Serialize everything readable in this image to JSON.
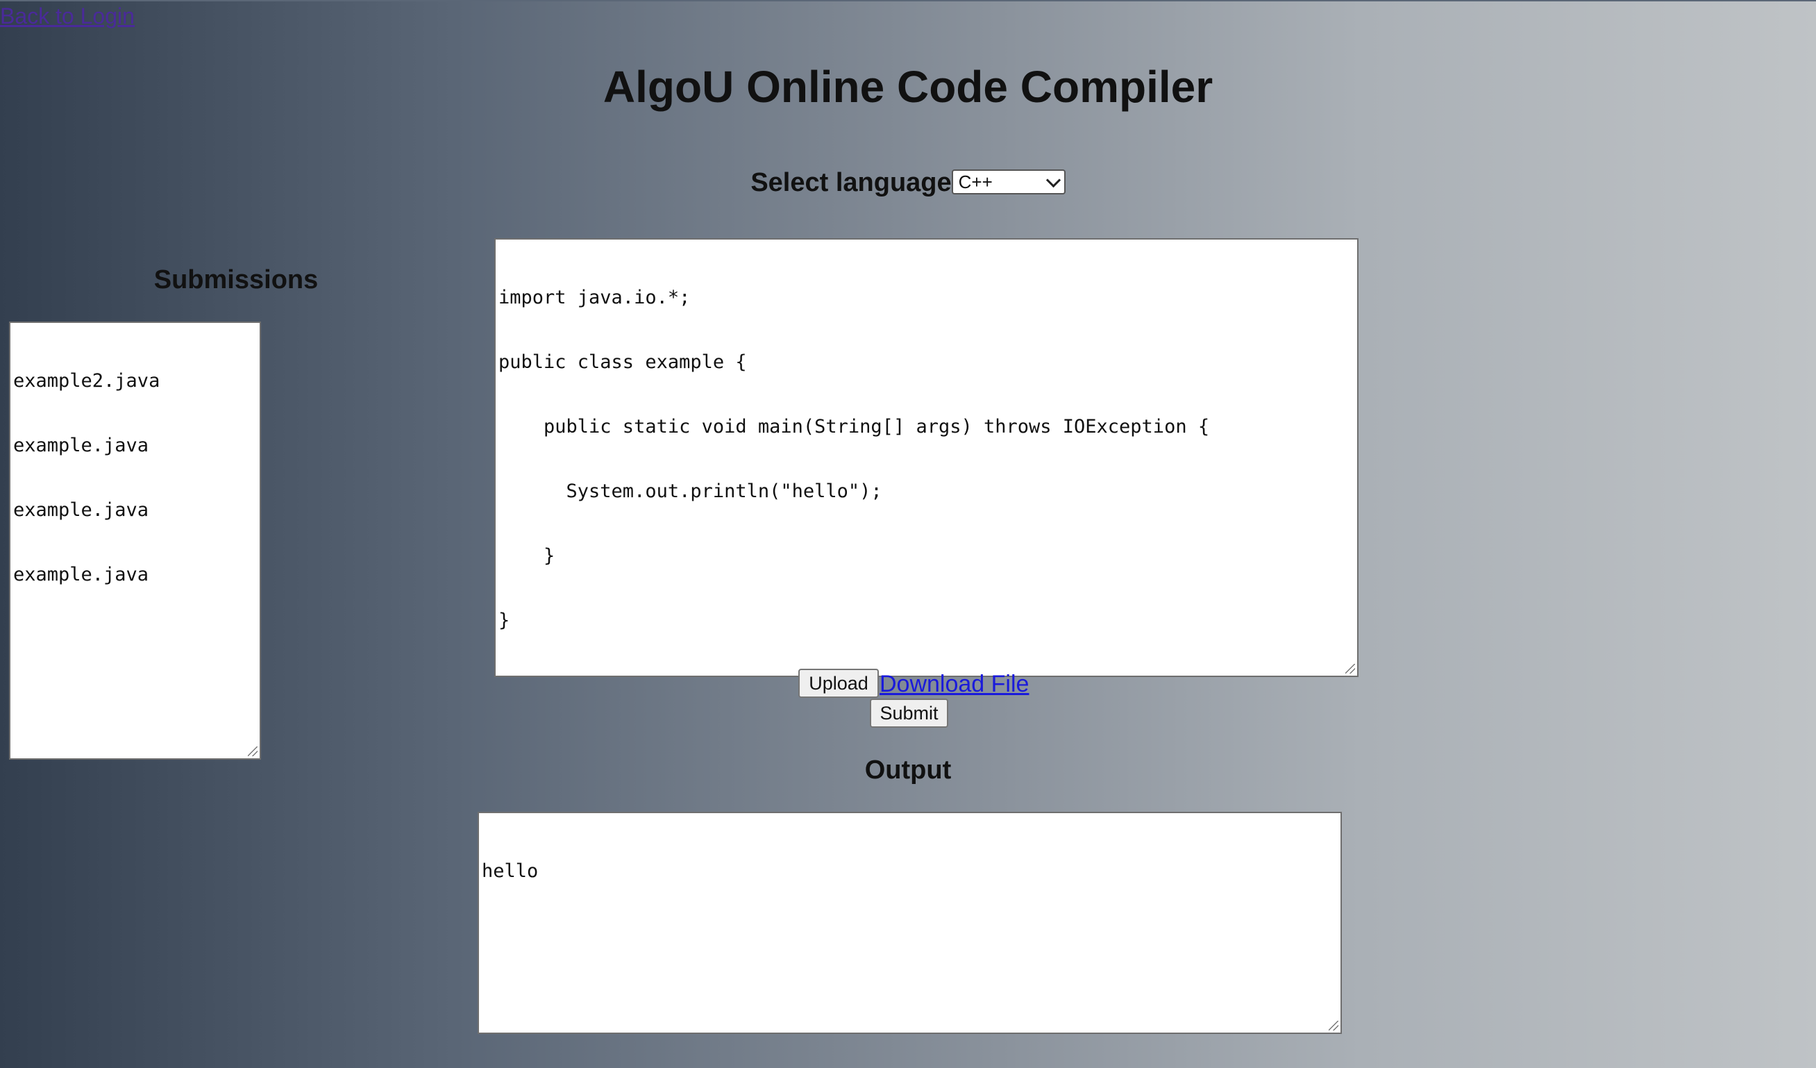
{
  "nav": {
    "back_label": "Back to Login"
  },
  "header": {
    "title": "AlgoU Online Code Compiler"
  },
  "language": {
    "label": "Select language",
    "selected": "C++"
  },
  "submissions": {
    "title": "Submissions",
    "items": [
      "example2.java",
      "example.java",
      "example.java",
      "example.java"
    ]
  },
  "editor": {
    "lines": [
      "import java.io.*;",
      "public class example {",
      "    public static void main(String[] args) throws IOException {",
      "      System.out.println(\"hello\");",
      "    }",
      "}"
    ]
  },
  "actions": {
    "upload_label": "Upload",
    "download_label": "Download File",
    "submit_label": "Submit"
  },
  "output": {
    "title": "Output",
    "text": "hello"
  }
}
